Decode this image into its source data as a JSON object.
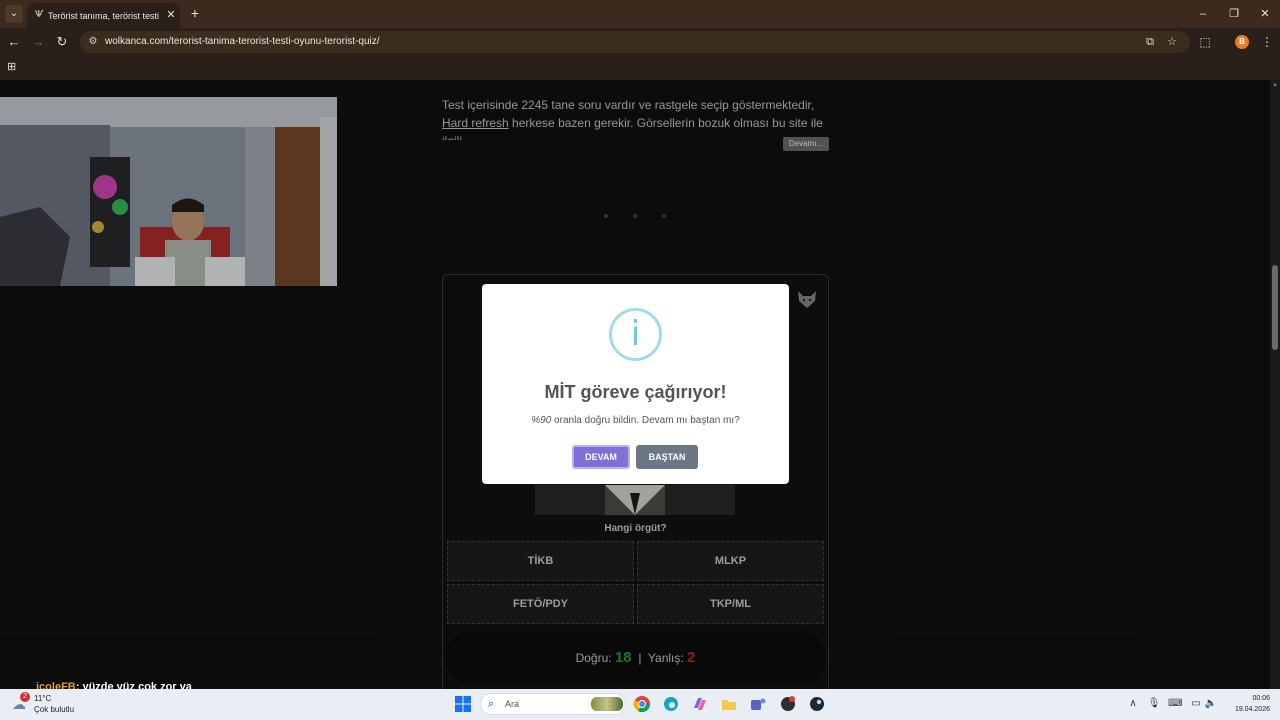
{
  "browser": {
    "tab_title": "Terörist tanıma, terörist testi oyunu",
    "url": "wolkanca.com/terorist-tanima-terorist-testi-oyunu-terorist-quiz/",
    "profile_initial": "B"
  },
  "article": {
    "paragraph_start": "Test içerisinde 2245 tane soru vardır ve rastgele seçip göstermektedir, ",
    "link_text": "Hard refresh",
    "paragraph_end": " herkese bazen gerekir. Görsellerin bozuk olması bu site ile ilgili",
    "more_button": "Devamı..."
  },
  "quiz": {
    "question": "Hangi örgüt?",
    "answers": [
      "TİKB",
      "MLKP",
      "FETÖ/PDY",
      "TKP/ML"
    ],
    "score_label_correct": "Doğru:",
    "correct_count": "18",
    "separator": "|",
    "score_label_wrong": "Yanlış:",
    "wrong_count": "2"
  },
  "modal": {
    "title": "MİT göreve çağırıyor!",
    "percent": "%90",
    "text": " oranla doğru bildin. Devam mı baştan mı?",
    "continue_button": "DEVAM",
    "restart_button": "BAŞTAN"
  },
  "chat": {
    "user": "jcoleFB",
    "message": ": yüzde yüz çok zor ya"
  },
  "taskbar": {
    "weather_temp": "11°C",
    "weather_desc": "Çok bulutlu",
    "weather_badge": "2",
    "search_placeholder": "Ara",
    "time": "00:06",
    "date": "19.04.2026"
  },
  "colors": {
    "correct": "#2e9a3a",
    "wrong": "#c0262d",
    "accent": "#7f6fd6",
    "info": "#6fc9dc"
  }
}
